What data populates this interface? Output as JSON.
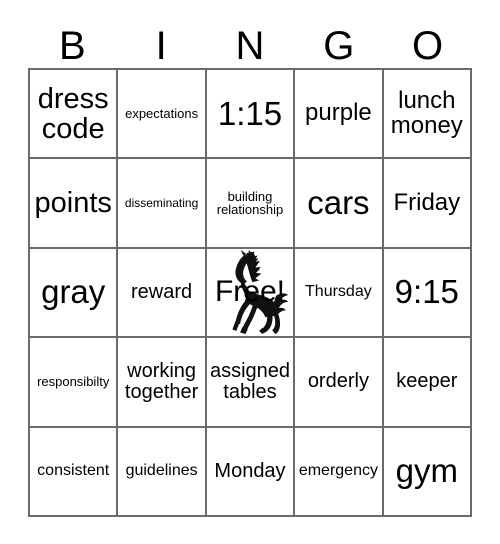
{
  "card": {
    "title": "BINGO",
    "header_letters": [
      "B",
      "I",
      "N",
      "G",
      "O"
    ],
    "free_space": {
      "label": "Free!",
      "art_icon": "rearing-horse-icon"
    },
    "colors": {
      "grid_line": "#6b6b6b",
      "text": "#000000",
      "background": "#ffffff"
    },
    "rows": [
      [
        {
          "text": "dress code",
          "size": "fs-xl"
        },
        {
          "text": "expectations",
          "size": "fs-xs"
        },
        {
          "text": "1:15",
          "size": "fs-xxl"
        },
        {
          "text": "purple",
          "size": "fs-lg"
        },
        {
          "text": "lunch money",
          "size": "fs-lg"
        }
      ],
      [
        {
          "text": "points",
          "size": "fs-xl"
        },
        {
          "text": "disseminating",
          "size": "fs-xxs"
        },
        {
          "text": "building relationship",
          "size": "fs-xs"
        },
        {
          "text": "cars",
          "size": "fs-xxl"
        },
        {
          "text": "Friday",
          "size": "fs-lg"
        }
      ],
      [
        {
          "text": "gray",
          "size": "fs-xxl"
        },
        {
          "text": "reward",
          "size": "fs-md"
        },
        {
          "text": "Free!",
          "size": "free"
        },
        {
          "text": "Thursday",
          "size": "fs-sm"
        },
        {
          "text": "9:15",
          "size": "fs-xxl"
        }
      ],
      [
        {
          "text": "responsibilty",
          "size": "fs-xs"
        },
        {
          "text": "working together",
          "size": "fs-md"
        },
        {
          "text": "assigned tables",
          "size": "fs-md"
        },
        {
          "text": "orderly",
          "size": "fs-md"
        },
        {
          "text": "keeper",
          "size": "fs-md"
        }
      ],
      [
        {
          "text": "consistent",
          "size": "fs-sm"
        },
        {
          "text": "guidelines",
          "size": "fs-sm"
        },
        {
          "text": "Monday",
          "size": "fs-md"
        },
        {
          "text": "emergency",
          "size": "fs-sm"
        },
        {
          "text": "gym",
          "size": "fs-xxl"
        }
      ]
    ]
  }
}
